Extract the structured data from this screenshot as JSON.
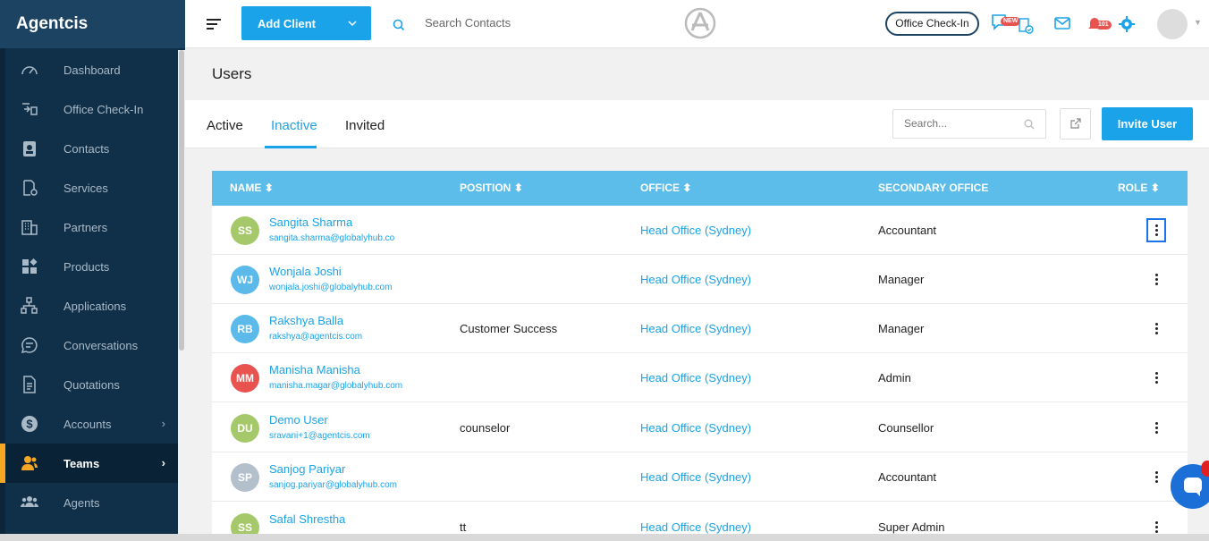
{
  "app": {
    "brand": "Agentcis"
  },
  "sidebar": {
    "items": [
      {
        "label": "Dashboard",
        "icon": "gauge-icon"
      },
      {
        "label": "Office Check-In",
        "icon": "check-in-icon"
      },
      {
        "label": "Contacts",
        "icon": "contact-card-icon"
      },
      {
        "label": "Services",
        "icon": "services-icon"
      },
      {
        "label": "Partners",
        "icon": "building-icon"
      },
      {
        "label": "Products",
        "icon": "products-icon"
      },
      {
        "label": "Applications",
        "icon": "flow-icon"
      },
      {
        "label": "Conversations",
        "icon": "chat-icon"
      },
      {
        "label": "Quotations",
        "icon": "document-icon"
      },
      {
        "label": "Accounts",
        "icon": "dollar-icon"
      },
      {
        "label": "Teams",
        "icon": "team-icon",
        "active": true
      },
      {
        "label": "Agents",
        "icon": "agents-icon"
      }
    ]
  },
  "topbar": {
    "add_client": "Add Client",
    "search_contacts": "Search Contacts",
    "office_checkin": "Office Check-In",
    "new_badge": "NEW",
    "notif_badge": "101"
  },
  "page": {
    "title": "Users"
  },
  "tabs": [
    {
      "label": "Active"
    },
    {
      "label": "Inactive",
      "active": true
    },
    {
      "label": "Invited"
    }
  ],
  "toolbar": {
    "search_placeholder": "Search...",
    "invite_label": "Invite User"
  },
  "table": {
    "headers": {
      "name": "NAME",
      "position": "POSITION",
      "office": "OFFICE",
      "secondary": "SECONDARY OFFICE",
      "role": "ROLE"
    },
    "rows": [
      {
        "initials": "SS",
        "color": "#a5c96a",
        "name": "Sangita Sharma",
        "email": "sangita.sharma@globalyhub.co",
        "position": "",
        "office": "Head Office (Sydney)",
        "secondary": "Accountant"
      },
      {
        "initials": "WJ",
        "color": "#5bbaea",
        "name": "Wonjala Joshi",
        "email": "wonjala.joshi@globalyhub.com",
        "position": "",
        "office": "Head Office (Sydney)",
        "secondary": "Manager"
      },
      {
        "initials": "RB",
        "color": "#5bbaea",
        "name": "Rakshya Balla",
        "email": "rakshya@agentcis.com",
        "position": "Customer Success",
        "office": "Head Office (Sydney)",
        "secondary": "Manager"
      },
      {
        "initials": "MM",
        "color": "#e8534f",
        "name": "Manisha Manisha",
        "email": "manisha.magar@globalyhub.com",
        "position": "",
        "office": "Head Office (Sydney)",
        "secondary": "Admin"
      },
      {
        "initials": "DU",
        "color": "#a5c96a",
        "name": "Demo User",
        "email": "sravani+1@agentcis.com",
        "position": "counselor",
        "office": "Head Office (Sydney)",
        "secondary": "Counsellor"
      },
      {
        "initials": "SP",
        "color": "#b4bfcc",
        "name": "Sanjog Pariyar",
        "email": "sanjog.pariyar@globalyhub.com",
        "position": "",
        "office": "Head Office (Sydney)",
        "secondary": "Accountant"
      },
      {
        "initials": "SS",
        "color": "#a5c96a",
        "name": "Safal Shrestha",
        "email": "",
        "position": "tt",
        "office": "Head Office (Sydney)",
        "secondary": "Super Admin"
      }
    ]
  },
  "colors": {
    "accent": "#1aa3e8",
    "sidebar": "#10304a",
    "header": "#5cbdeb",
    "active_marker": "#f5a623"
  }
}
